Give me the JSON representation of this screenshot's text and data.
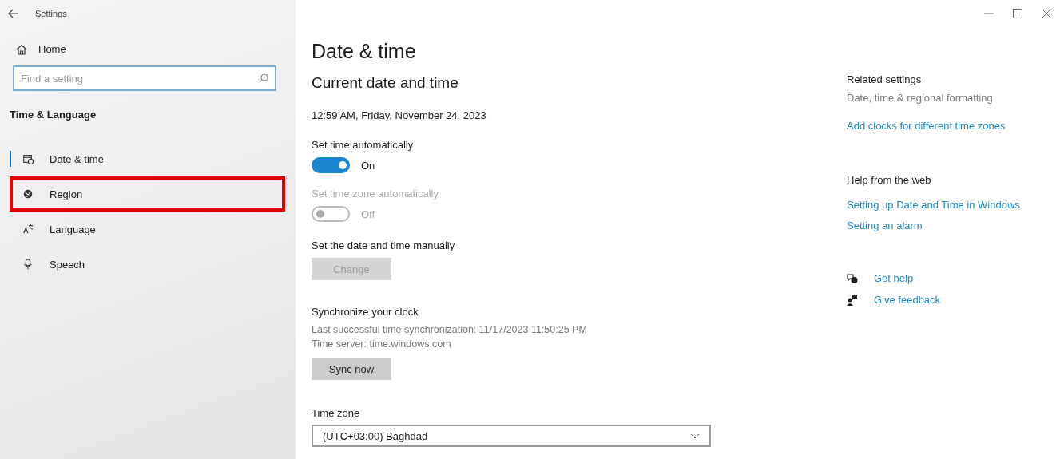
{
  "window": {
    "title": "Settings"
  },
  "sidebar": {
    "home": "Home",
    "search": {
      "placeholder": "Find a setting"
    },
    "section": "Time & Language",
    "items": [
      {
        "label": "Date & time",
        "selected": true,
        "highlighted": false
      },
      {
        "label": "Region",
        "selected": false,
        "highlighted": true
      },
      {
        "label": "Language",
        "selected": false,
        "highlighted": false
      },
      {
        "label": "Speech",
        "selected": false,
        "highlighted": false
      }
    ]
  },
  "main": {
    "title": "Date & time",
    "subtitle": "Current date and time",
    "current": "12:59 AM, Friday, November 24, 2023",
    "toggles": [
      {
        "label": "Set time automatically",
        "on": true,
        "disabled": false,
        "state_text": "On"
      },
      {
        "label": "Set time zone automatically",
        "on": false,
        "disabled": true,
        "state_text": "Off"
      }
    ],
    "manual": {
      "label": "Set the date and time manually",
      "button": {
        "label": "Change",
        "disabled": true
      }
    },
    "sync": {
      "title": "Synchronize your clock",
      "lines": [
        "Last successful time synchronization: 11/17/2023 11:50:25 PM",
        "Time server: time.windows.com"
      ],
      "button": {
        "label": "Sync now",
        "disabled": false
      }
    },
    "time_zone": {
      "label": "Time zone",
      "value": "(UTC+03:00) Baghdad"
    }
  },
  "related": {
    "title": "Related settings",
    "items": [
      {
        "label": "Date, time & regional formatting",
        "kind": "text"
      },
      {
        "label": "Add clocks for different time zones",
        "kind": "link"
      }
    ]
  },
  "help": {
    "title": "Help from the web",
    "links": [
      "Setting up Date and Time in Windows",
      "Setting an alarm"
    ]
  },
  "support": [
    {
      "label": "Get help",
      "kind": "help"
    },
    {
      "label": "Give feedback",
      "kind": "feedback"
    }
  ]
}
